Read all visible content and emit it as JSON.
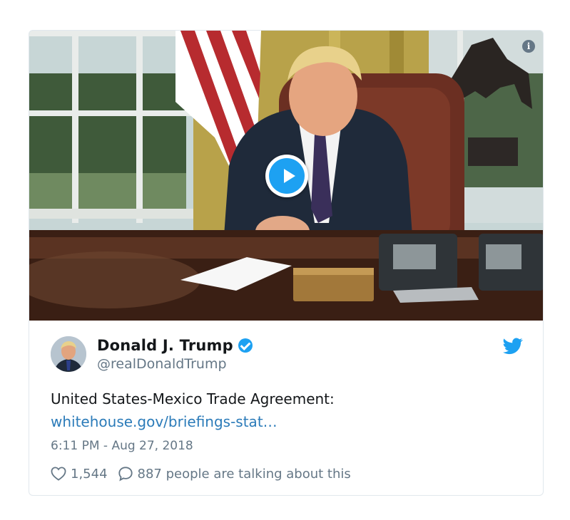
{
  "media": {
    "play_icon": "play-icon",
    "info_icon": "info-icon",
    "info_glyph": "i"
  },
  "tweet": {
    "name": "Donald J. Trump",
    "handle": "@realDonaldTrump",
    "verified_icon": "verified-badge-icon",
    "brand_icon": "twitter-bird-icon",
    "text": "United States-Mexico Trade Agreement:",
    "link": "whitehouse.gov/briefings-stat…",
    "timestamp": "6:11 PM - Aug 27, 2018",
    "likes": "1,544",
    "replies_text": "887 people are talking about this"
  },
  "colors": {
    "brand_blue": "#1da1f2",
    "link": "#2b7bb9",
    "muted": "#657786",
    "text": "#14171a",
    "border": "#e1e8ed"
  }
}
